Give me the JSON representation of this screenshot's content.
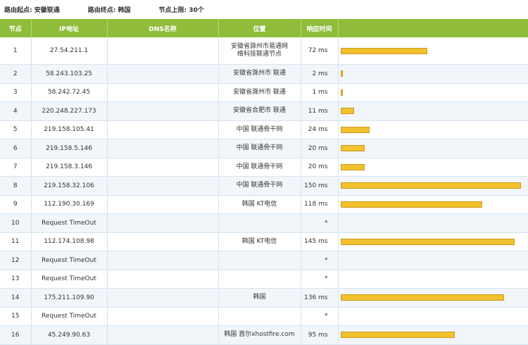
{
  "header": {
    "start_label": "路由起点: 安徽联通",
    "end_label": "路由终点: 韩国",
    "limit_label": "节点上限: 30个"
  },
  "columns": [
    "节点",
    "IP地址",
    "DNS名称",
    "位置",
    "响应时间",
    ""
  ],
  "rows": [
    {
      "node": "1",
      "ip": "27.54.211.1",
      "dns": "",
      "loc": "安徽省滁州市易通网络科技联通节点",
      "time": "72 ms",
      "ms": 72
    },
    {
      "node": "2",
      "ip": "58.243.103.25",
      "dns": "",
      "loc": "安徽省滁州市 联通",
      "time": "2 ms",
      "ms": 2
    },
    {
      "node": "3",
      "ip": "58.242.72.45",
      "dns": "",
      "loc": "安徽省滁州市 联通",
      "time": "1 ms",
      "ms": 1
    },
    {
      "node": "4",
      "ip": "220.248.227.173",
      "dns": "",
      "loc": "安徽省合肥市 联通",
      "time": "11 ms",
      "ms": 11
    },
    {
      "node": "5",
      "ip": "219.158.105.41",
      "dns": "",
      "loc": "中国 联通骨干网",
      "time": "24 ms",
      "ms": 24
    },
    {
      "node": "6",
      "ip": "219.158.5.146",
      "dns": "",
      "loc": "中国 联通骨干网",
      "time": "20 ms",
      "ms": 20
    },
    {
      "node": "7",
      "ip": "219.158.3.146",
      "dns": "",
      "loc": "中国 联通骨干网",
      "time": "20 ms",
      "ms": 20
    },
    {
      "node": "8",
      "ip": "219.158.32.106",
      "dns": "",
      "loc": "中国 联通骨干网",
      "time": "150 ms",
      "ms": 150
    },
    {
      "node": "9",
      "ip": "112.190.30.169",
      "dns": "",
      "loc": "韩国 KT电信",
      "time": "118 ms",
      "ms": 118
    },
    {
      "node": "10",
      "ip": "Request TimeOut",
      "dns": "",
      "loc": "",
      "time": "*",
      "ms": 0
    },
    {
      "node": "11",
      "ip": "112.174.108.98",
      "dns": "",
      "loc": "韩国 KT电信",
      "time": "145 ms",
      "ms": 145
    },
    {
      "node": "12",
      "ip": "Request TimeOut",
      "dns": "",
      "loc": "",
      "time": "*",
      "ms": 0
    },
    {
      "node": "13",
      "ip": "Request TimeOut",
      "dns": "",
      "loc": "",
      "time": "*",
      "ms": 0
    },
    {
      "node": "14",
      "ip": "175.211.109.90",
      "dns": "",
      "loc": "韩国",
      "time": "136 ms",
      "ms": 136
    },
    {
      "node": "15",
      "ip": "Request TimeOut",
      "dns": "",
      "loc": "",
      "time": "*",
      "ms": 0
    },
    {
      "node": "16",
      "ip": "45.249.90.63",
      "dns": "",
      "loc": "韩国 首尔xhostfire.com",
      "time": "95 ms",
      "ms": 95
    }
  ]
}
